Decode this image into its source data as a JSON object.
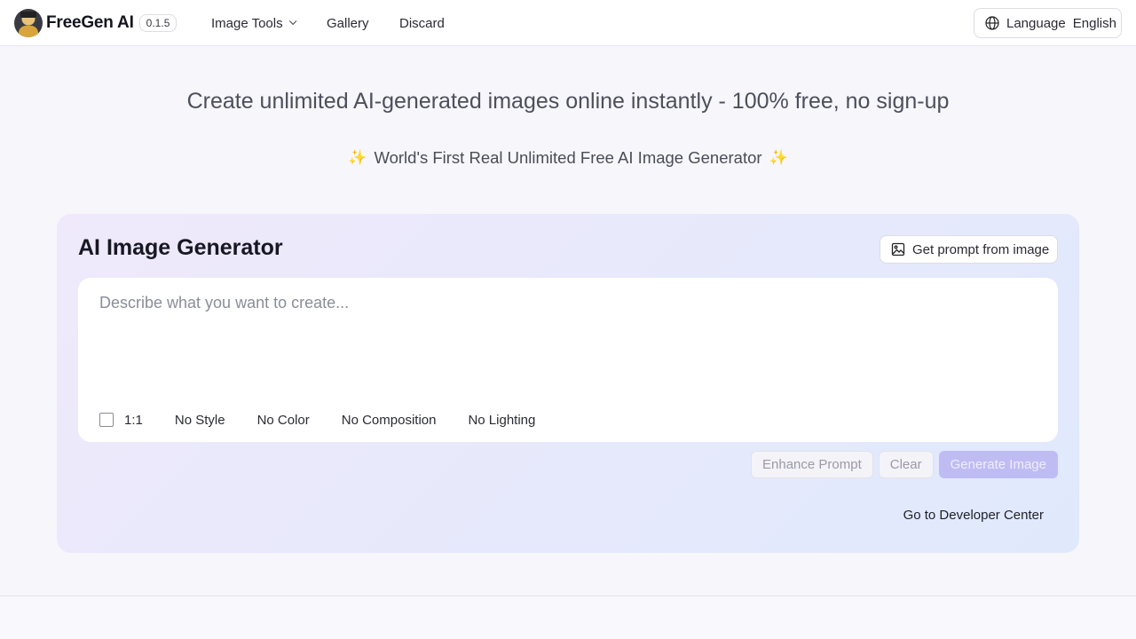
{
  "header": {
    "brand": "FreeGen AI",
    "version": "0.1.5",
    "nav": {
      "image_tools": "Image Tools",
      "gallery": "Gallery",
      "discard": "Discard"
    },
    "language_label": "Language",
    "language_value": "English"
  },
  "hero": {
    "title": "Create unlimited AI-generated images online instantly - 100% free, no sign-up",
    "subtitle": "World's First Real Unlimited Free AI Image Generator",
    "sparkle_icon": "sparkle-icon"
  },
  "generator": {
    "title": "AI Image Generator",
    "get_prompt_button": "Get prompt from image",
    "prompt_placeholder": "Describe what you want to create...",
    "prompt_value": "",
    "options": {
      "aspect_ratio": "1:1",
      "style": "No Style",
      "color": "No Color",
      "composition": "No Composition",
      "lighting": "No Lighting"
    },
    "buttons": {
      "enhance": "Enhance Prompt",
      "clear": "Clear",
      "generate": "Generate Image"
    },
    "developer_link": "Go to Developer Center"
  },
  "colors": {
    "accent": "#bfbcf4",
    "sparkle": "#f1b84a"
  }
}
